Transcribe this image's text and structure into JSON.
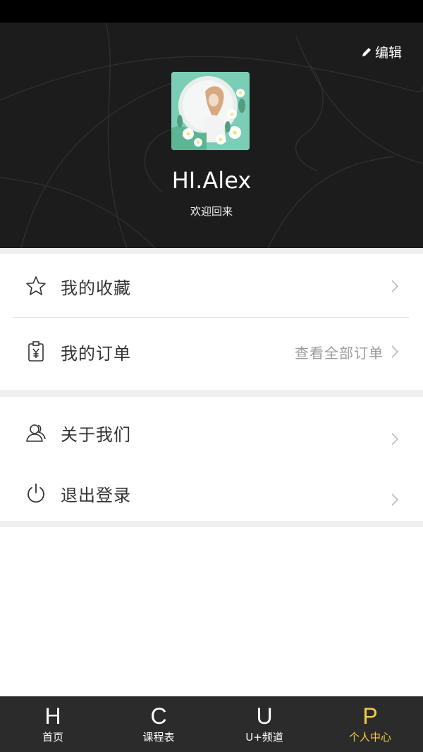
{
  "header": {
    "edit_label": "编辑",
    "username": "HI.Alex",
    "welcome": "欢迎回来"
  },
  "menu": {
    "favorites": {
      "label": "我的收藏",
      "icon": "star-icon"
    },
    "orders": {
      "label": "我的订单",
      "extra": "查看全部订单",
      "icon": "receipt-yen-icon"
    },
    "about": {
      "label": "关于我们",
      "icon": "users-icon"
    },
    "logout": {
      "label": "退出登录",
      "icon": "power-icon"
    }
  },
  "tabs": [
    {
      "letter": "H",
      "label": "首页"
    },
    {
      "letter": "C",
      "label": "课程表"
    },
    {
      "letter": "U",
      "label": "U+频道"
    },
    {
      "letter": "P",
      "label": "个人中心"
    }
  ],
  "colors": {
    "header_bg": "#1c1c1c",
    "tabbar_bg": "#2b2b2b",
    "active_tab": "#f6cd3e",
    "separator": "#efefef"
  }
}
